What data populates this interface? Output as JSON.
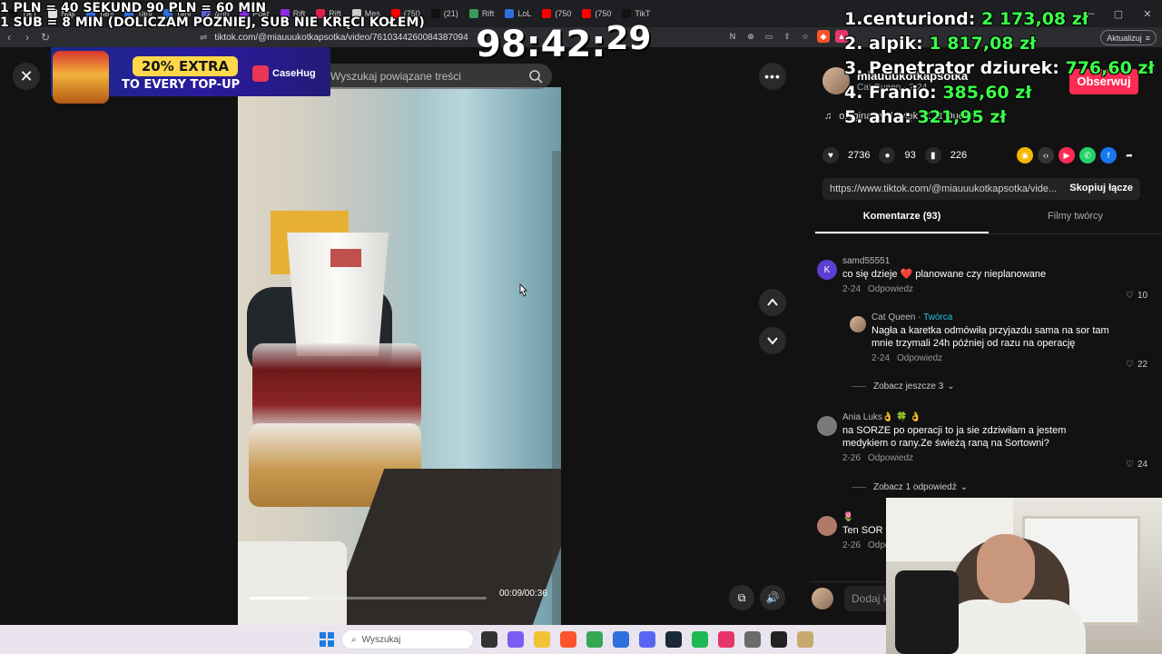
{
  "browser": {
    "tabs": [
      {
        "label": "TikT",
        "color": "#111111"
      },
      {
        "label": "Najl",
        "color": "#e0e0e0"
      },
      {
        "label": "Tani",
        "color": "#2f6fe0"
      },
      {
        "label": "Tani",
        "color": "#2f6fe0"
      },
      {
        "label": "Tani",
        "color": "#2f6fe0"
      },
      {
        "label": "Ahri",
        "color": "#5b5bd6"
      },
      {
        "label": "Pokr",
        "color": "#8a2be2"
      },
      {
        "label": "Rift",
        "color": "#8a2be2"
      },
      {
        "label": "Rift",
        "color": "#e0204a"
      },
      {
        "label": "Mes",
        "color": "#cccccc"
      },
      {
        "label": "(750",
        "color": "#ff0000"
      },
      {
        "label": "(21)",
        "color": "#111111"
      },
      {
        "label": "Rift",
        "color": "#3a9a5a"
      },
      {
        "label": "LoL",
        "color": "#2f6fe0"
      },
      {
        "label": "(750",
        "color": "#ff0000"
      },
      {
        "label": "(750",
        "color": "#ff0000"
      },
      {
        "label": "TikT",
        "color": "#111111"
      }
    ],
    "url": "tiktok.com/@miauuukotkapsotka/video/7610344260084387094",
    "update_label": "Aktualizuj"
  },
  "tiktok": {
    "search_placeholder": "Wyszukaj powiązane treści",
    "video_time": "00:09/00:36",
    "progress": 0.25,
    "author_name": "miauuukotkapsotka",
    "author_meta": "Cat Queen · 2-24",
    "follow_label": "Obserwuj",
    "music": "oryginalny dźwięk - Cat Queen",
    "likes": "2736",
    "comments_count": "93",
    "saves": "226",
    "link": "https://www.tiktok.com/@miauuukotkapsotka/vide...",
    "copy_label": "Skopiuj łącze",
    "tab_comments": "Komentarze (93)",
    "tab_creator": "Filmy twórcy",
    "add_comment_placeholder": "Dodaj komentarz...",
    "reply_label": "Odpowiedz",
    "comments": [
      {
        "user": "samd55551",
        "avatar_letter": "K",
        "avatar_color": "#5b3fd1",
        "text": "co się dzieje ❤️ planowane czy nieplanowane",
        "date": "2-24",
        "likes": "10"
      },
      {
        "user": "Cat Queen",
        "badge": "Twórca",
        "text": "Nagła a karetka odmówiła przyjazdu sama na sor tam mnie trzymali 24h później od razu na operację",
        "date": "2-24",
        "likes": "22",
        "more": "Zobacz jeszcze 3"
      },
      {
        "user": "Ania Luks👌 🍀 👌",
        "text": "na SORZE po operacji to ja sie zdziwiłam a jestem medykiem o rany.Ze świeżą raną na Sortowni?",
        "date": "2-26",
        "likes": "24",
        "more": "Zobacz 1 odpowiedź"
      },
      {
        "user": "🌷",
        "text": "Ten SOR t",
        "date": "2-26",
        "likes": ""
      }
    ]
  },
  "promo": {
    "percent": "20% EXTRA",
    "sub": "TO EVERY TOP-UP",
    "brand": "CaseHug"
  },
  "overlay": {
    "line1": "1 PLN =  40 SEKUND 90 PLN = 60 MIN",
    "line2": "1 SUB = 8 MIN (DOLICZAM PÓŹNIEJ, SUB NIE KRĘCI KOŁEM)",
    "timer_main": "98:42:",
    "timer_sec": "29",
    "leaderboard": [
      {
        "name": "1.centuriond: ",
        "amount": "2 173,08 zł"
      },
      {
        "name": "2. alpik: ",
        "amount": "1 817,08 zł"
      },
      {
        "name": "3. Penetrator dziurek: ",
        "amount": "776,60 zł"
      },
      {
        "name": "4. Franio: ",
        "amount": "385,60 zł"
      },
      {
        "name": "5. aha: ",
        "amount": "321,95 zł"
      }
    ]
  },
  "taskbar": {
    "search_label": "Wyszukaj"
  }
}
